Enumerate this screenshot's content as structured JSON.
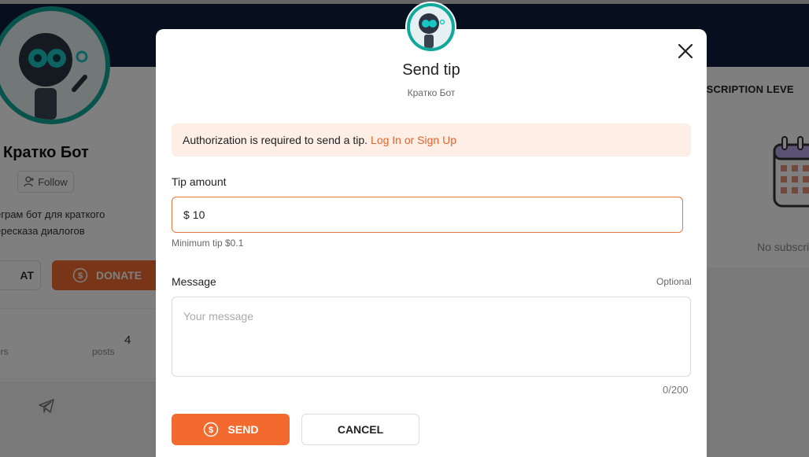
{
  "profile": {
    "name": "Кратко Бот",
    "follow_label": "Follow",
    "bio_line1": "еграм бот для краткого",
    "bio_line2": "ересказа диалогов",
    "chat_label": "AT",
    "donate_label": "DONATE",
    "posts_count": "4",
    "posts_label": "posts",
    "followers_label": "ers"
  },
  "subscriptions": {
    "title": "BSCRIPTION LEVE",
    "empty_text": "No subscri"
  },
  "modal": {
    "title": "Send tip",
    "subtitle": "Кратко Бот",
    "alert_text": "Authorization is required to send a tip.",
    "alert_link": "Log In or Sign Up",
    "tip_label": "Tip amount",
    "currency": "$",
    "tip_value": "10",
    "min_hint": "Minimum tip $0.1",
    "message_label": "Message",
    "optional_label": "Optional",
    "message_placeholder": "Your message",
    "counter": "0/200",
    "send_label": "SEND",
    "cancel_label": "CANCEL"
  },
  "colors": {
    "accent": "#f36a2f",
    "cover": "#0e1f3d",
    "avatar_ring": "#10a89b",
    "alert_bg": "#fdeee6"
  },
  "icons": [
    "robot-avatar",
    "follow-user-icon",
    "dollar-coin-icon",
    "telegram-icon",
    "calendar-icon",
    "close-icon"
  ]
}
